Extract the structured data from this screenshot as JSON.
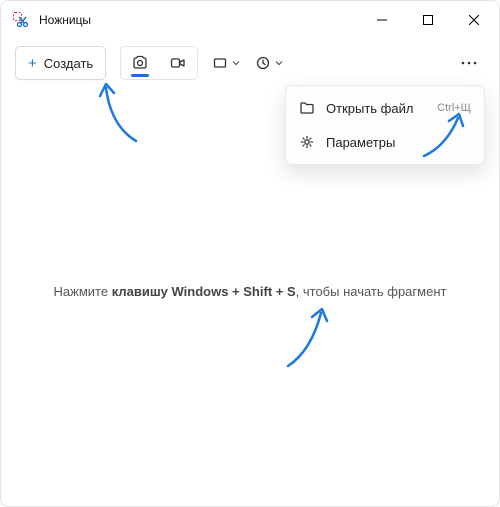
{
  "title": "Ножницы",
  "toolbar": {
    "create_label": "Создать"
  },
  "menu": {
    "open_file": "Открыть файл",
    "open_file_shortcut": "Ctrl+Щ",
    "settings": "Параметры"
  },
  "hint": {
    "prefix": "Нажмите ",
    "bold": "клавишу Windows + Shift + S",
    "suffix": ", чтобы начать фрагмент"
  },
  "colors": {
    "accent": "#1a6fd6",
    "arrow": "#1e79df"
  }
}
